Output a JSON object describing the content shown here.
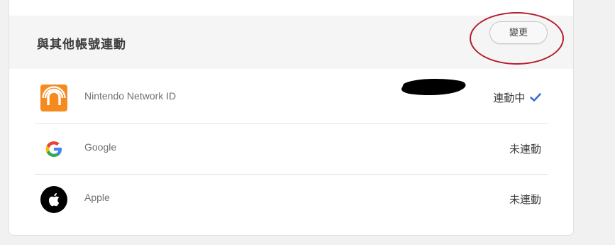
{
  "linked_accounts": {
    "title": "與其他帳號連動",
    "change_button_label": "變更"
  },
  "accounts": [
    {
      "icon": "nintendo-network-icon",
      "name": "Nintendo Network ID",
      "status": "連動中",
      "linked": true,
      "brand_color": "#f58a1f"
    },
    {
      "icon": "google-icon",
      "name": "Google",
      "status": "未連動",
      "linked": false
    },
    {
      "icon": "apple-icon",
      "name": "Apple",
      "status": "未連動",
      "linked": false
    }
  ],
  "colors": {
    "check_mark": "#3a6fd1",
    "annotation": "#b31b2c"
  }
}
